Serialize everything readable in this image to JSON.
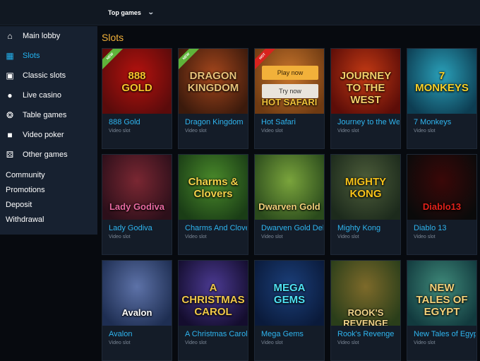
{
  "header": {
    "dropdown_label": "Top games"
  },
  "sidebar": {
    "items": [
      {
        "label": "Main lobby",
        "icon": "home-icon",
        "active": false
      },
      {
        "label": "Slots",
        "icon": "slot-machine-icon",
        "active": true
      },
      {
        "label": "Classic slots",
        "icon": "classic-slots-icon",
        "active": false
      },
      {
        "label": "Live casino",
        "icon": "dealer-icon",
        "active": false
      },
      {
        "label": "Table games",
        "icon": "roulette-icon",
        "active": false
      },
      {
        "label": "Video poker",
        "icon": "cards-icon",
        "active": false
      },
      {
        "label": "Other games",
        "icon": "dice-icon",
        "active": false
      }
    ],
    "links": [
      "Community",
      "Promotions",
      "Deposit",
      "Withdrawal"
    ]
  },
  "main": {
    "title": "Slots",
    "games": [
      {
        "name": "888 Gold",
        "type": "Video slot",
        "badge": "NEW",
        "thumb_title": "888\nGOLD",
        "colors": [
          "#5a0b0b",
          "#b5120e"
        ],
        "title_color": "#f7c52c"
      },
      {
        "name": "Dragon Kingdom",
        "type": "Video slot",
        "badge": "NEW",
        "thumb_title": "DRAGON\nKINGDOM",
        "colors": [
          "#3b1a0c",
          "#a4461c"
        ],
        "title_color": "#e9c27a"
      },
      {
        "name": "Hot Safari",
        "type": "Video slot",
        "badge": "HOT",
        "thumb_title": "HOT SAFARI",
        "colors": [
          "#6e3a12",
          "#c9762c"
        ],
        "title_color": "#f0c23a",
        "hover": [
          "Play now",
          "Try now"
        ]
      },
      {
        "name": "Journey to the West",
        "type": "Video slot",
        "badge": "",
        "thumb_title": "JOURNEY\nTO THE WEST",
        "colors": [
          "#5c0d08",
          "#c43a14"
        ],
        "title_color": "#f4cf6a"
      },
      {
        "name": "7 Monkeys",
        "type": "Video slot",
        "badge": "",
        "thumb_title": "7\nMONKEYS",
        "colors": [
          "#0d3d52",
          "#2aa0b9"
        ],
        "title_color": "#f6d12a"
      },
      {
        "name": "Lady Godiva",
        "type": "Video slot",
        "badge": "",
        "thumb_title": "Lady Godiva",
        "colors": [
          "#2c0f1a",
          "#7a2732"
        ],
        "title_color": "#e96aa1"
      },
      {
        "name": "Charms And Clovers",
        "type": "Video slot",
        "badge": "",
        "thumb_title": "Charms &\nClovers",
        "colors": [
          "#1a3d16",
          "#4a8a2a"
        ],
        "title_color": "#f4d24a"
      },
      {
        "name": "Dwarven Gold Deluxe",
        "type": "Video slot",
        "badge": "",
        "thumb_title": "Dwarven Gold",
        "colors": [
          "#2a4a1c",
          "#7aa43c"
        ],
        "title_color": "#f0d07a"
      },
      {
        "name": "Mighty Kong",
        "type": "Video slot",
        "badge": "",
        "thumb_title": "MIGHTY\nKONG",
        "colors": [
          "#1c2a1c",
          "#4d5d3a"
        ],
        "title_color": "#f6c21a"
      },
      {
        "name": "Diablo 13",
        "type": "Video slot",
        "badge": "",
        "thumb_title": "Diablo13",
        "colors": [
          "#0a0a0a",
          "#3a0808"
        ],
        "title_color": "#e3211a"
      },
      {
        "name": "Avalon",
        "type": "Video slot",
        "badge": "",
        "thumb_title": "Avalon",
        "colors": [
          "#1e2e52",
          "#5d72a8"
        ],
        "title_color": "#ffffff"
      },
      {
        "name": "A Christmas Carol",
        "type": "Video slot",
        "badge": "",
        "thumb_title": "A CHRISTMAS\nCAROL",
        "colors": [
          "#140d2e",
          "#4b3a92"
        ],
        "title_color": "#f0c84a"
      },
      {
        "name": "Mega Gems",
        "type": "Video slot",
        "badge": "",
        "thumb_title": "MEGA\nGEMS",
        "colors": [
          "#0a1a3a",
          "#1b3f7a"
        ],
        "title_color": "#4fe1f3"
      },
      {
        "name": "Rook's Revenge",
        "type": "Video slot",
        "badge": "",
        "thumb_title": "ROOK'S REVENGE",
        "colors": [
          "#2a3e1a",
          "#7d6a2a"
        ],
        "title_color": "#f0d38a"
      },
      {
        "name": "New Tales of Egypt",
        "type": "Video slot",
        "badge": "",
        "thumb_title": "NEW\nTALES OF EGYPT",
        "colors": [
          "#123a3e",
          "#3f8a7a"
        ],
        "title_color": "#f4d27a"
      }
    ]
  },
  "colors": {
    "accent": "#23b3f0",
    "title": "#f2b13a",
    "sidebar_bg": "#172130",
    "card_bg": "#141c28",
    "badge_new": "#5fb43a",
    "badge_hot": "#d8231e"
  }
}
